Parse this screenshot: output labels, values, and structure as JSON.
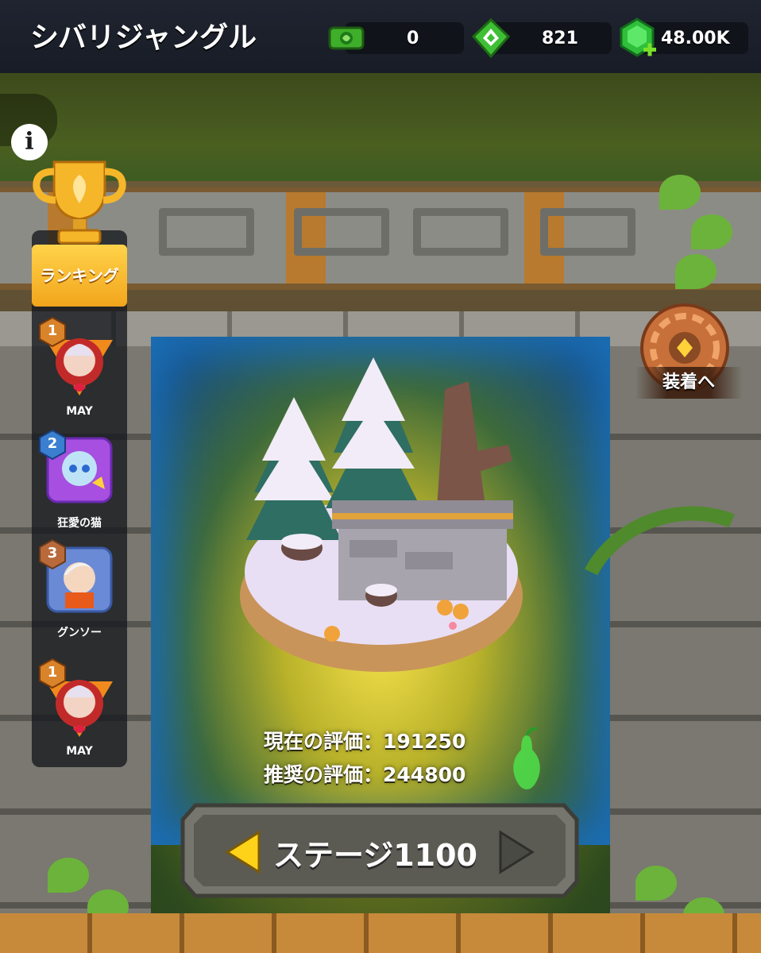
{
  "header": {
    "title": "シバリジャングル",
    "resources": [
      {
        "name": "ticket",
        "value": "0",
        "icon": "green-ticket-icon"
      },
      {
        "name": "gem",
        "value": "821",
        "icon": "green-gem-icon"
      },
      {
        "name": "emerald",
        "value": "48.00K",
        "icon": "emerald-add-icon"
      }
    ]
  },
  "info_button": {
    "icon": "info-icon",
    "glyph": "i"
  },
  "ranking": {
    "button_label": "ランキング",
    "entries": [
      {
        "rank": "1",
        "name": "MAY"
      },
      {
        "rank": "2",
        "name": "狂愛の猫"
      },
      {
        "rank": "3",
        "name": "グンソー"
      },
      {
        "rank": "1",
        "name": "MAY"
      }
    ]
  },
  "equip": {
    "label": "装着へ"
  },
  "ratings": {
    "current_label": "現在の評価：",
    "current_value": "191250",
    "recommended_label": "推奨の評価：",
    "recommended_value": "244800"
  },
  "stage": {
    "label": "ステージ1100"
  },
  "colors": {
    "accent_gold": "#f2a51c",
    "accent_green": "#4fbf2a",
    "portal_blue": "#1b6fb7"
  }
}
